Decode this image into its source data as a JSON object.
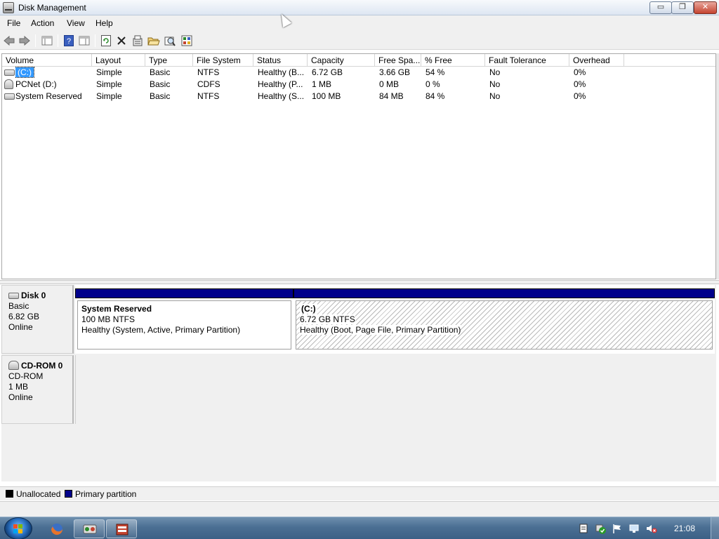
{
  "window": {
    "title": "Disk Management",
    "buttons": {
      "minimize": "▭",
      "maximize": "❐",
      "close": "✕"
    }
  },
  "menu": [
    {
      "label": "File",
      "hotkey": "F"
    },
    {
      "label": "Action",
      "hotkey": "A"
    },
    {
      "label": "View",
      "hotkey": "V"
    },
    {
      "label": "Help",
      "hotkey": "H"
    }
  ],
  "toolbar": {
    "icons": [
      "back-icon",
      "forward-icon",
      "console-tree-icon",
      "help-icon",
      "list-view-icon",
      "refresh-icon",
      "delete-icon",
      "properties-icon",
      "open-icon",
      "explore-icon",
      "rescan-icon"
    ]
  },
  "volume_list": {
    "columns": [
      "Volume",
      "Layout",
      "Type",
      "File System",
      "Status",
      "Capacity",
      "Free Spa...",
      "% Free",
      "Fault Tolerance",
      "Overhead"
    ],
    "rows": [
      {
        "volume": "(C:)",
        "layout": "Simple",
        "type": "Basic",
        "fs": "NTFS",
        "status": "Healthy (B...",
        "capacity": "6.72 GB",
        "free": "3.66 GB",
        "pct": "54 %",
        "fault": "No",
        "overhead": "0%",
        "icon": "hard-disk-icon",
        "selected": true
      },
      {
        "volume": "PCNet (D:)",
        "layout": "Simple",
        "type": "Basic",
        "fs": "CDFS",
        "status": "Healthy (P...",
        "capacity": "1 MB",
        "free": "0 MB",
        "pct": "0 %",
        "fault": "No",
        "overhead": "0%",
        "icon": "cd-drive-icon",
        "selected": false
      },
      {
        "volume": "System Reserved",
        "layout": "Simple",
        "type": "Basic",
        "fs": "NTFS",
        "status": "Healthy (S...",
        "capacity": "100 MB",
        "free": "84 MB",
        "pct": "84 %",
        "fault": "No",
        "overhead": "0%",
        "icon": "hard-disk-icon",
        "selected": false
      }
    ]
  },
  "disks": [
    {
      "name": "Disk 0",
      "type": "Basic",
      "size": "6.82 GB",
      "state": "Online",
      "partitions": [
        {
          "name": "System Reserved",
          "fs": "100 MB NTFS",
          "status": "Healthy (System, Active, Primary Partition)"
        },
        {
          "name": "(C:)",
          "fs": "6.72 GB NTFS",
          "status": "Healthy (Boot, Page File, Primary Partition)"
        }
      ]
    },
    {
      "name": "CD-ROM 0",
      "type": "CD-ROM",
      "size": "1 MB",
      "state": "Online"
    }
  ],
  "legend": [
    {
      "label": "Unallocated",
      "color": "#000000"
    },
    {
      "label": "Primary partition",
      "color": "#00008b"
    }
  ],
  "taskbar": {
    "clock": "21:08",
    "apps": [
      "firefox-icon",
      "network-app-icon",
      "disk-management-icon"
    ],
    "tray": [
      "action-center-icon",
      "security-icon",
      "flag-icon",
      "network-icon",
      "volume-muted-icon"
    ]
  }
}
